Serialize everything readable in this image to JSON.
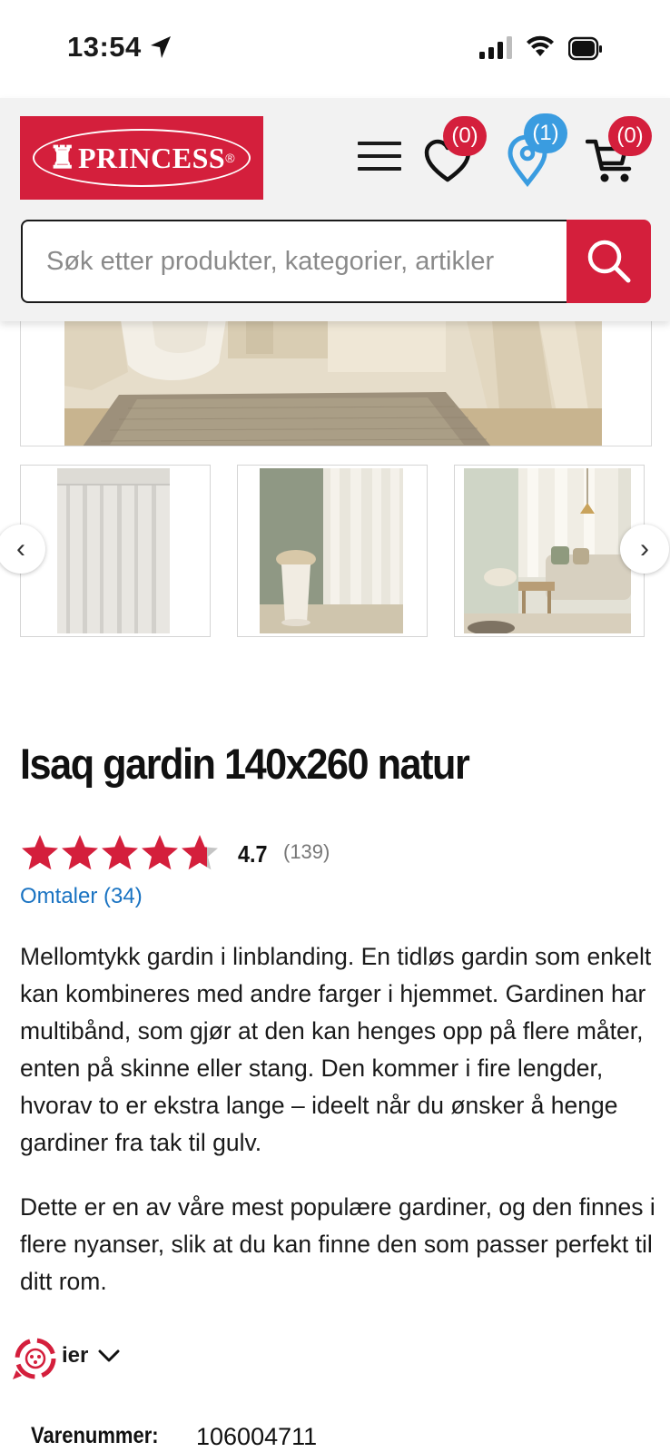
{
  "status_bar": {
    "time": "13:54"
  },
  "header": {
    "logo_text": "PRINCESS",
    "logo_mark": "®",
    "wishlist_count": "(0)",
    "store_count": "(1)",
    "cart_count": "(0)",
    "icons": [
      "hamburger-menu-icon",
      "heart-icon",
      "location-pin-icon",
      "cart-icon"
    ],
    "accent_color": "#d41f3c",
    "store_badge_color": "#3a9ce0"
  },
  "search": {
    "placeholder": "Søk etter produkter, kategorier, artikler",
    "value": ""
  },
  "gallery": {
    "prev_label": "‹",
    "next_label": "›"
  },
  "product": {
    "title": "Isaq gardin 140x260 natur",
    "rating": {
      "value": "4.7",
      "stars_filled": 4.7,
      "stars_total": 5,
      "count": "(139)"
    },
    "reviews_link": "Omtaler (34)",
    "description": [
      "Mellomtykk gardin i linblanding. En tidløs gardin som enkelt kan kombineres med andre farger i hjemmet. Gardinen har multibånd, som gjør at den kan henges opp på flere måter, enten på skinne eller stang. Den kommer i fire lengder, hvorav to er ekstra lange – ideelt når du ønsker å henge gardiner fra tak til gulv.",
      "Dette er en av våre mest populære gardiner, og den finnes i flere nyanser, slik at du kan finne den som passer perfekt til ditt rom."
    ],
    "spec_toggle_label": "ier",
    "sku": {
      "label": "Varenummer:",
      "value": "106004711"
    }
  }
}
